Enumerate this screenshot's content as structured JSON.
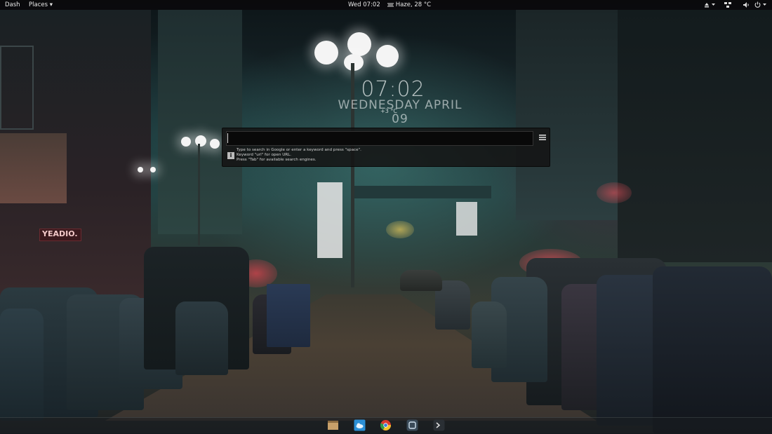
{
  "top_panel": {
    "dash_label": "Dash",
    "places_label": "Places ▾",
    "datetime": "Wed 07:02",
    "weather": "Haze, 28 °C",
    "indicators": [
      "eject-icon",
      "network-icon",
      "volume-icon",
      "power-icon"
    ]
  },
  "clock": {
    "time": "07:02",
    "date": "WEDNESDAY APRIL 09",
    "temperature": "+3 °C"
  },
  "search": {
    "input_value": "",
    "hint_line1": "Type to search in Google or enter a keyword and press \"space\".",
    "hint_line2": "Keyword \"url\" for open URL.",
    "hint_line3": "Press \"Tab\" for available search engines."
  },
  "dock": {
    "apps": [
      "files-icon",
      "weather-icon",
      "chrome-icon",
      "settings-icon",
      "terminal-icon"
    ]
  },
  "wallpaper": {
    "sign_text": "YEADIO."
  },
  "colors": {
    "panel": "#0a0a0c",
    "search_bg": "#141414",
    "accent_teal": "#4e9a92"
  }
}
